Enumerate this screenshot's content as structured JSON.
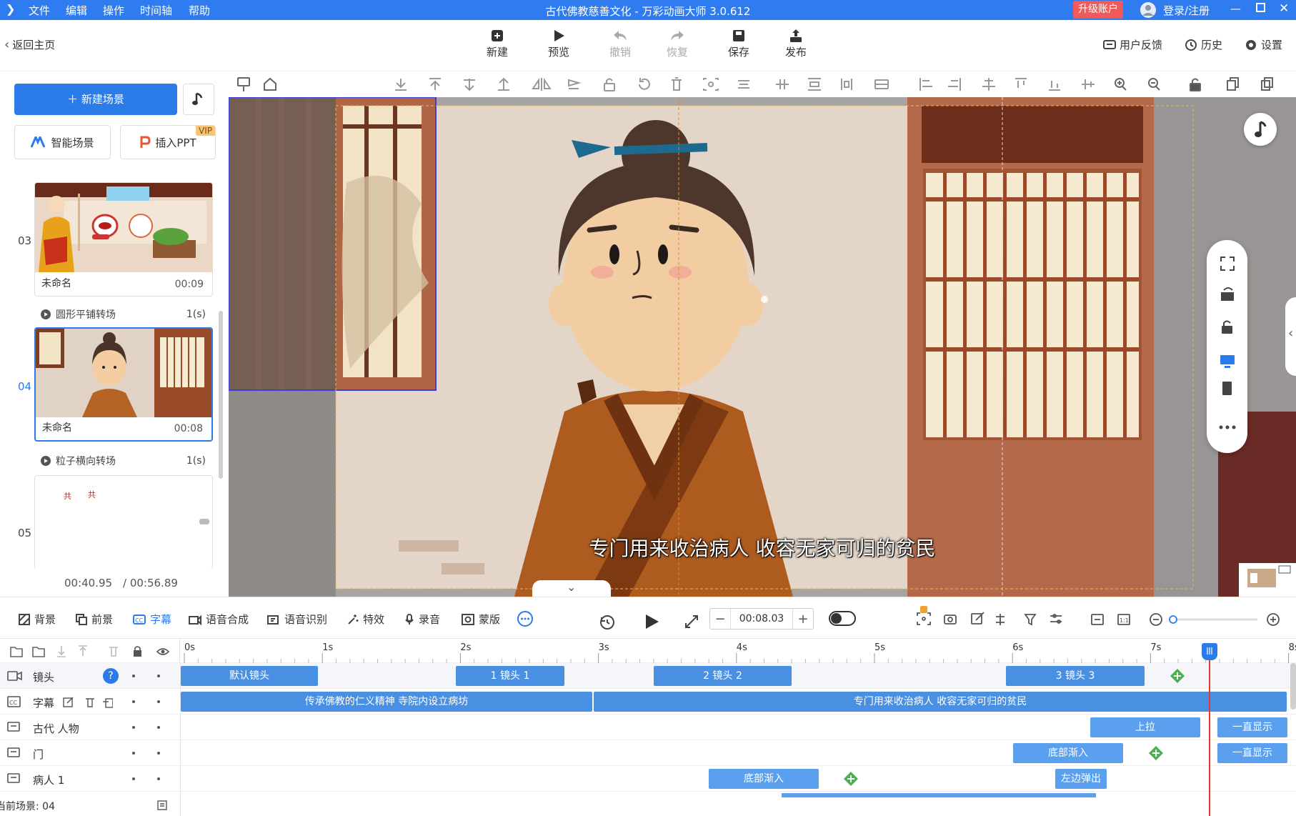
{
  "titlebar": {
    "menus": [
      "文件",
      "编辑",
      "操作",
      "时间轴",
      "帮助"
    ],
    "title": "古代佛教慈善文化 - 万彩动画大师 3.0.612",
    "upgrade": "升级账户",
    "login": "登录/注册"
  },
  "toolbar": {
    "back": "返回主页",
    "buttons": [
      {
        "label": "新建",
        "icon": "new-icon"
      },
      {
        "label": "预览",
        "icon": "play-icon"
      },
      {
        "label": "撤销",
        "icon": "undo-icon"
      },
      {
        "label": "恢复",
        "icon": "redo-icon"
      },
      {
        "label": "保存",
        "icon": "save-icon"
      },
      {
        "label": "发布",
        "icon": "publish-icon"
      }
    ],
    "feedback": "用户反馈",
    "history": "历史",
    "settings": "设置"
  },
  "left": {
    "new_scene": "新建场景",
    "smart_scene": "智能场景",
    "insert_ppt": "插入PPT",
    "vip": "VIP",
    "scenes": [
      {
        "num": "03",
        "name": "未命名",
        "duration": "00:09"
      },
      {
        "num": "04",
        "name": "未命名",
        "duration": "00:08"
      },
      {
        "num": "05",
        "name": "",
        "duration": ""
      }
    ],
    "transitions": [
      {
        "name": "圆形平铺转场",
        "duration": "1(s)"
      },
      {
        "name": "粒子横向转场",
        "duration": "1(s)"
      }
    ],
    "time_current": "00:40.95",
    "time_total": "/ 00:56.89"
  },
  "canvas": {
    "subtitle": "专门用来收治病人 收容无家可归的贫民"
  },
  "bottom": {
    "tabs": [
      "背景",
      "前景",
      "字幕",
      "语音合成",
      "语音识别",
      "特效",
      "录音",
      "蒙版"
    ],
    "active_tab": "字幕",
    "time": "00:08.03"
  },
  "timeline": {
    "ruler": [
      "0s",
      "1s",
      "2s",
      "3s",
      "4s",
      "5s",
      "6s",
      "7s",
      "8s"
    ],
    "tracks": [
      {
        "name": "镜头",
        "clips": [
          {
            "label": "默认镜头"
          },
          {
            "label": "1 镜头 1"
          },
          {
            "label": "2 镜头 2"
          },
          {
            "label": "3 镜头 3"
          }
        ]
      },
      {
        "name": "字幕",
        "clips": [
          {
            "label": "传承佛教的仁义精神   寺院内设立病坊"
          },
          {
            "label": "专门用来收治病人 收容无家可归的贫民"
          }
        ]
      },
      {
        "name": "古代 人物",
        "clips": [
          {
            "label": "上拉"
          },
          {
            "label": "一直显示"
          }
        ]
      },
      {
        "name": "门",
        "clips": [
          {
            "label": "底部渐入"
          },
          {
            "label": "一直显示"
          }
        ]
      },
      {
        "name": "病人 1",
        "clips": [
          {
            "label": "底部渐入"
          },
          {
            "label": "左边弹出"
          }
        ]
      }
    ],
    "current_scene": "当前场景: 04"
  },
  "colors": {
    "accent": "#2b7ce9",
    "titlebar": "#2f7bf0",
    "upgrade": "#f05a5a",
    "clip": "#4a90e2"
  }
}
